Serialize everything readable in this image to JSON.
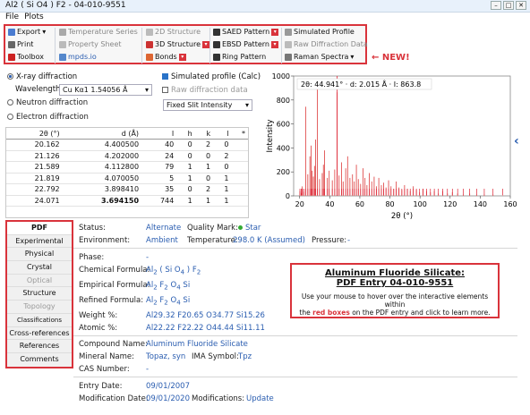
{
  "window": {
    "title": "Al2 ( Si O4 ) F2 - 04-010-9551"
  },
  "menu": {
    "file": "File",
    "plots": "Plots"
  },
  "toolbar": {
    "export": "Export",
    "print": "Print",
    "toolbox": "Toolbox",
    "temperature_series": "Temperature Series",
    "property_sheet": "Property Sheet",
    "mpds": "mpds.io",
    "structure_2d": "2D Structure",
    "structure_3d": "3D Structure",
    "bonds": "Bonds",
    "saed": "SAED Pattern",
    "ebsd": "EBSD Pattern",
    "ring": "Ring Pattern",
    "simulated_profile": "Simulated Profile",
    "raw_diffraction": "Raw Diffraction Data",
    "raman": "Raman Spectra",
    "new_label": "← NEW!"
  },
  "diffraction": {
    "xray": "X-ray diffraction",
    "wavelength_label": "Wavelength:",
    "wavelength_value": "Cu Kα1 1.54056 Å",
    "neutron": "Neutron diffraction",
    "electron": "Electron diffraction",
    "sim_profile": "Simulated profile (Calc)",
    "raw_data": "Raw diffraction data",
    "slit": "Fixed Slit Intensity"
  },
  "table": {
    "headers": [
      "2θ (°)",
      "d (Å)",
      "I",
      "h",
      "k",
      "l",
      "*"
    ],
    "rows": [
      [
        "20.162",
        "4.400500",
        "40",
        "0",
        "2",
        "0",
        ""
      ],
      [
        "21.126",
        "4.202000",
        "24",
        "0",
        "0",
        "2",
        ""
      ],
      [
        "21.589",
        "4.112800",
        "79",
        "1",
        "1",
        "0",
        ""
      ],
      [
        "21.819",
        "4.070050",
        "5",
        "1",
        "0",
        "1",
        ""
      ],
      [
        "22.792",
        "3.898410",
        "35",
        "0",
        "2",
        "1",
        ""
      ],
      [
        "24.071",
        "3.694150",
        "744",
        "1",
        "1",
        "1",
        ""
      ]
    ]
  },
  "chart_data": {
    "type": "bar",
    "title": "",
    "readout": "2θ: 44.941°  ·  d: 2.015 Å  ·  I: 863.8",
    "xlabel": "2θ (°)",
    "ylabel": "Intensity",
    "xlim": [
      16,
      160
    ],
    "ylim": [
      0,
      1000
    ],
    "xticks": [
      20,
      40,
      60,
      80,
      100,
      120,
      140,
      160
    ],
    "yticks": [
      0,
      200,
      400,
      600,
      800,
      1000
    ],
    "x": [
      20.16,
      21.13,
      21.59,
      21.82,
      22.79,
      24.07,
      25.4,
      26.8,
      27.6,
      28.3,
      29.1,
      29.9,
      30.6,
      31.8,
      33.2,
      35.0,
      35.8,
      36.5,
      38.4,
      39.6,
      41.7,
      43.3,
      44.9,
      46.2,
      47.8,
      48.9,
      50.6,
      51.9,
      53.4,
      55.1,
      56.3,
      57.7,
      59.0,
      60.5,
      62.1,
      63.4,
      64.7,
      66.3,
      67.9,
      69.5,
      71.0,
      72.6,
      74.3,
      75.8,
      77.4,
      79.1,
      80.7,
      82.5,
      84.2,
      86.0,
      87.9,
      89.7,
      91.6,
      93.5,
      95.5,
      97.6,
      99.7,
      102.0,
      104.4,
      106.9,
      109.5,
      112.2,
      115.1,
      118.2,
      121.5,
      125.0,
      128.8,
      133.0,
      137.6,
      142.7,
      148.5,
      155.0
    ],
    "y": [
      40,
      24,
      79,
      5,
      35,
      744,
      180,
      330,
      420,
      210,
      160,
      250,
      470,
      890,
      140,
      190,
      260,
      380,
      150,
      210,
      130,
      220,
      864,
      170,
      280,
      120,
      230,
      330,
      150,
      180,
      120,
      260,
      140,
      100,
      230,
      150,
      90,
      190,
      120,
      160,
      80,
      150,
      90,
      110,
      70,
      130,
      80,
      60,
      120,
      70,
      50,
      90,
      60,
      40,
      80,
      50,
      30,
      60,
      40,
      30,
      40,
      20,
      40,
      20,
      30,
      20,
      10,
      20,
      10,
      10,
      10,
      5
    ]
  },
  "tabs": [
    "PDF",
    "Experimental",
    "Physical",
    "Crystal",
    "Optical",
    "Structure",
    "Topology",
    "Classifications",
    "Cross-references",
    "References",
    "Comments"
  ],
  "info": {
    "status_label": "Status:",
    "status_value": "Alternate",
    "quality_label": "Quality Mark:",
    "quality_value": "Star",
    "env_label": "Environment:",
    "env_value": "Ambient",
    "temp_label": "Temperature:",
    "temp_value": "298.0 K (Assumed)",
    "pressure_label": "Pressure:",
    "pressure_value": "-",
    "phase_label": "Phase:",
    "phase_value": "-",
    "chem_label": "Chemical Formula:",
    "emp_label": "Empirical Formula:",
    "ref_label": "Refined Formula:",
    "weight_label": "Weight %:",
    "weight_value": "Al29.32 F20.65 O34.77 Si15.26",
    "atomic_label": "Atomic %:",
    "atomic_value": "Al22.22 F22.22 O44.44 Si11.11",
    "compound_label": "Compound Name:",
    "compound_value": "Aluminum Fluoride Silicate",
    "mineral_label": "Mineral Name:",
    "mineral_value": "Topaz, syn",
    "ima_label": "IMA Symbol:",
    "ima_value": "Tpz",
    "cas_label": "CAS Number:",
    "cas_value": "-",
    "entry_label": "Entry Date:",
    "entry_value": "09/01/2007",
    "mod_label": "Modification Date:",
    "mod_value": "09/01/2020",
    "mods_label": "Modifications:",
    "mods_value": "Update"
  },
  "box": {
    "title": "Aluminum Fluoride Silicate:",
    "subtitle": "PDF Entry 04-010-9551",
    "body1": "Use your mouse to hover over the interactive elements within",
    "body2a": "the ",
    "body2b": "red boxes",
    "body2c": " on the PDF entry and click to learn more."
  },
  "colors": {
    "accent": "#d9333b",
    "link": "#2a5db0",
    "peak": "#e05050"
  }
}
